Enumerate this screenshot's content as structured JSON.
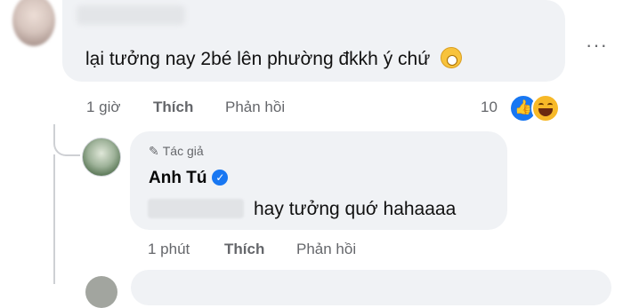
{
  "comment": {
    "text": "lại tưởng nay 2bé lên phường đkkh ý chứ",
    "emoji": "shocked-face-emoji",
    "time": "1 giờ",
    "like_label": "Thích",
    "reply_label": "Phản hồi",
    "reaction_count": "10",
    "reactions": [
      "like-icon",
      "haha-icon"
    ],
    "more_label": "···"
  },
  "reply": {
    "author_badge": "Tác giả",
    "author_name": "Anh Tú",
    "text": "hay tưởng quớ hahaaaa",
    "time": "1 phút",
    "like_label": "Thích",
    "reply_label": "Phản hồi"
  },
  "colors": {
    "bubble_bg": "#f0f2f5",
    "meta_text": "#65676b",
    "brand_blue": "#1877f2",
    "haha_yellow": "#f7b928"
  }
}
